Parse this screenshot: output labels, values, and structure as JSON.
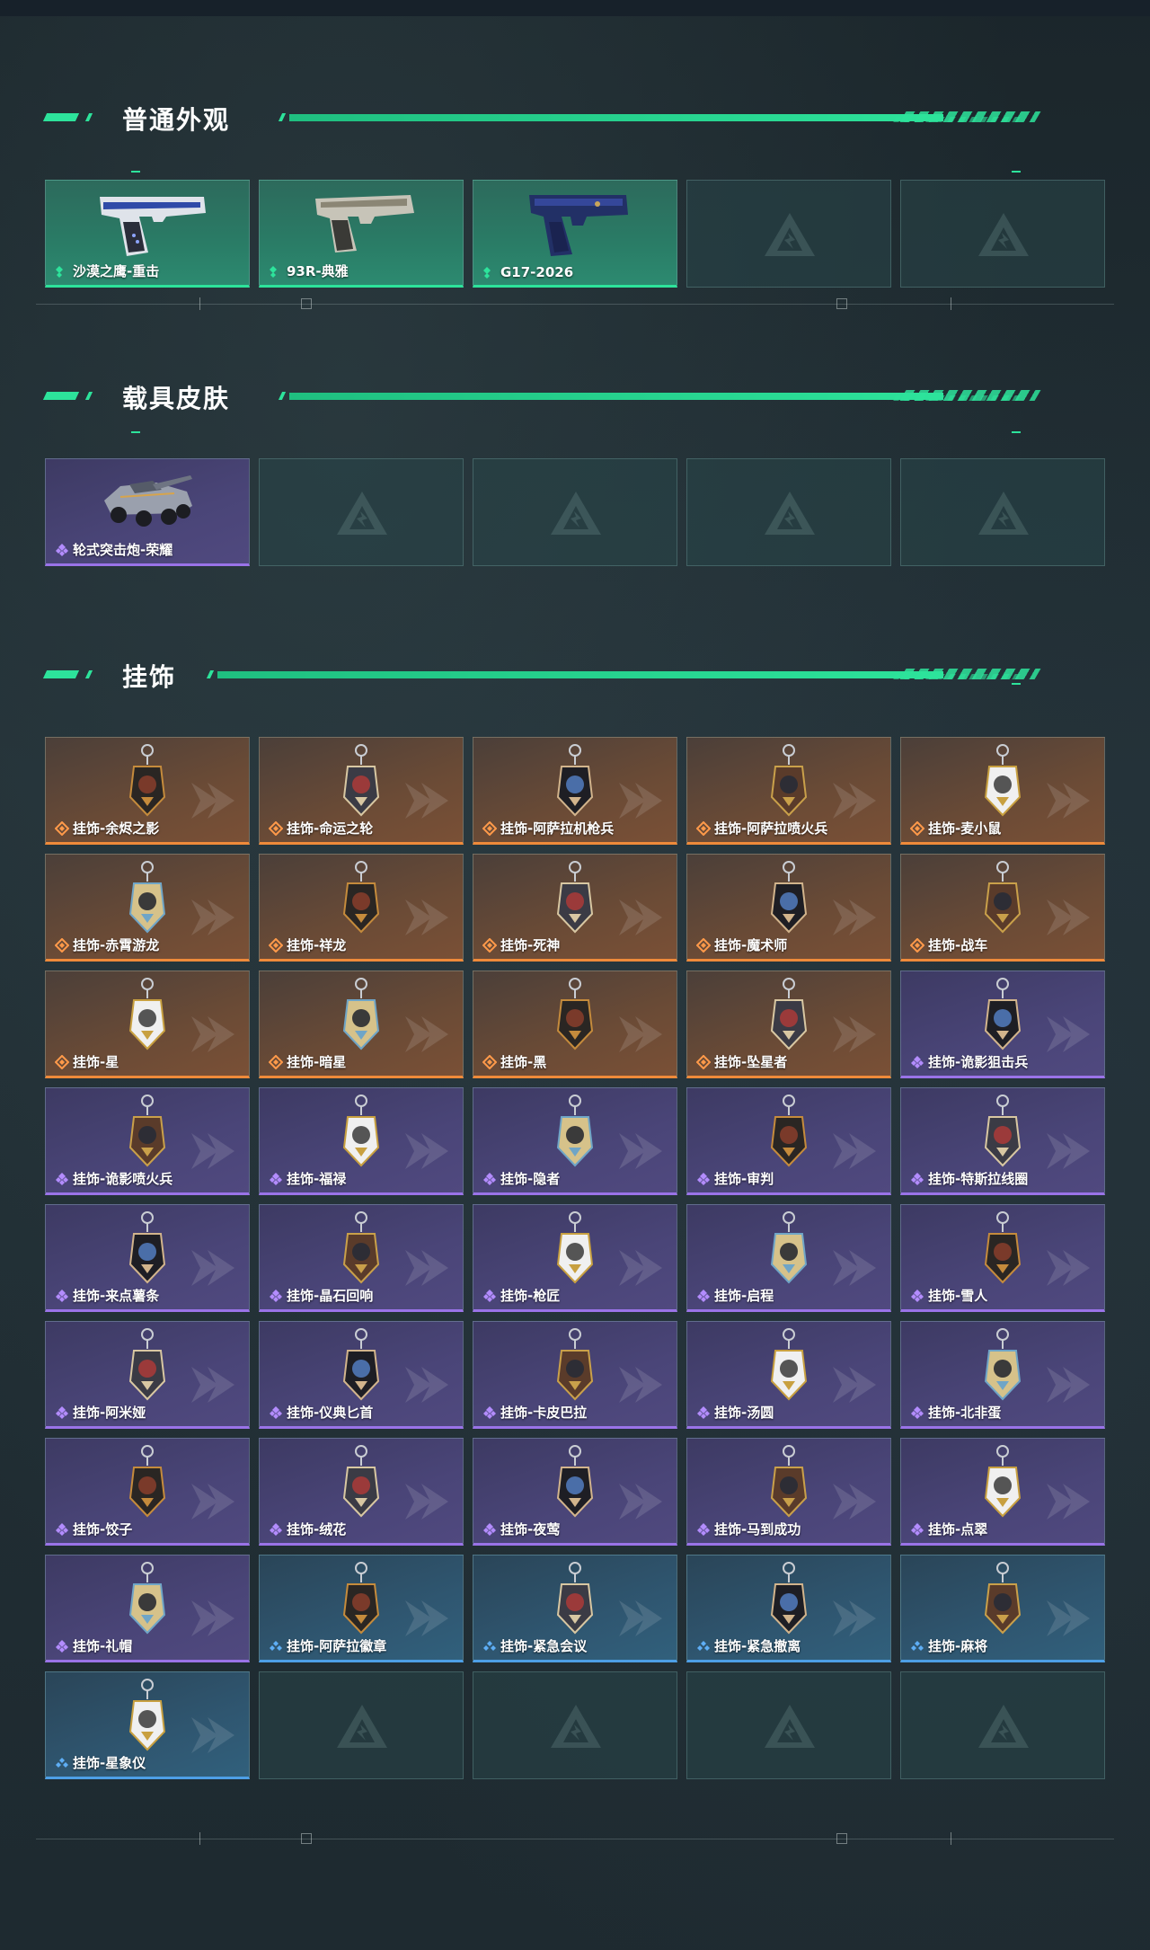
{
  "sections": [
    {
      "title": "普通外观",
      "items": [
        {
          "label": "沙漠之鹰-重击",
          "rarity": "green",
          "icon": "pistol-icon"
        },
        {
          "label": "93R-典雅",
          "rarity": "green",
          "icon": "pistol-icon"
        },
        {
          "label": "G17-2026",
          "rarity": "green",
          "icon": "pistol-icon"
        },
        {
          "empty": true
        },
        {
          "empty": true
        }
      ]
    },
    {
      "title": "载具皮肤",
      "items": [
        {
          "label": "轮式突击炮-荣耀",
          "rarity": "purple",
          "icon": "vehicle-icon"
        },
        {
          "empty": true
        },
        {
          "empty": true
        },
        {
          "empty": true
        },
        {
          "empty": true
        }
      ]
    },
    {
      "title": "挂饰",
      "items": [
        {
          "label": "挂饰-余烬之影",
          "rarity": "orange",
          "icon": "charm-figure-icon"
        },
        {
          "label": "挂饰-命运之轮",
          "rarity": "orange",
          "icon": "charm-card-icon"
        },
        {
          "label": "挂饰-阿萨拉机枪兵",
          "rarity": "orange",
          "icon": "charm-figure-icon"
        },
        {
          "label": "挂饰-阿萨拉喷火兵",
          "rarity": "orange",
          "icon": "charm-figure-icon"
        },
        {
          "label": "挂饰-麦小鼠",
          "rarity": "orange",
          "icon": "charm-mouse-icon"
        },
        {
          "label": "挂饰-赤霄游龙",
          "rarity": "orange",
          "icon": "charm-dragon-icon"
        },
        {
          "label": "挂饰-祥龙",
          "rarity": "orange",
          "icon": "charm-dragon-icon"
        },
        {
          "label": "挂饰-死神",
          "rarity": "orange",
          "icon": "charm-card-icon"
        },
        {
          "label": "挂饰-魔术师",
          "rarity": "orange",
          "icon": "charm-card-icon"
        },
        {
          "label": "挂饰-战车",
          "rarity": "orange",
          "icon": "charm-card-icon"
        },
        {
          "label": "挂饰-星",
          "rarity": "orange",
          "icon": "charm-card-icon"
        },
        {
          "label": "挂饰-暗星",
          "rarity": "orange",
          "icon": "charm-blade-icon"
        },
        {
          "label": "挂饰-黑",
          "rarity": "orange",
          "icon": "charm-tag-icon"
        },
        {
          "label": "挂饰-坠星者",
          "rarity": "orange",
          "icon": "charm-crystal-icon"
        },
        {
          "label": "挂饰-诡影狙击兵",
          "rarity": "purple",
          "icon": "charm-figure-icon"
        },
        {
          "label": "挂饰-诡影喷火兵",
          "rarity": "purple",
          "icon": "charm-figure-icon"
        },
        {
          "label": "挂饰-福禄",
          "rarity": "purple",
          "icon": "charm-gourd-icon"
        },
        {
          "label": "挂饰-隐者",
          "rarity": "purple",
          "icon": "charm-card-icon"
        },
        {
          "label": "挂饰-审判",
          "rarity": "purple",
          "icon": "charm-card-icon"
        },
        {
          "label": "挂饰-特斯拉线圈",
          "rarity": "purple",
          "icon": "charm-coil-icon"
        },
        {
          "label": "挂饰-来点薯条",
          "rarity": "purple",
          "icon": "charm-fries-icon"
        },
        {
          "label": "挂饰-晶石回响",
          "rarity": "purple",
          "icon": "charm-crystal-icon"
        },
        {
          "label": "挂饰-枪匠",
          "rarity": "purple",
          "icon": "charm-box-icon"
        },
        {
          "label": "挂饰-启程",
          "rarity": "purple",
          "icon": "charm-ring-icon"
        },
        {
          "label": "挂饰-雪人",
          "rarity": "purple",
          "icon": "charm-snowman-icon"
        },
        {
          "label": "挂饰-阿米娅",
          "rarity": "purple",
          "icon": "charm-figure-icon"
        },
        {
          "label": "挂饰-仪典匕首",
          "rarity": "purple",
          "icon": "charm-blade-icon"
        },
        {
          "label": "挂饰-卡皮巴拉",
          "rarity": "purple",
          "icon": "charm-capybara-icon"
        },
        {
          "label": "挂饰-汤圆",
          "rarity": "purple",
          "icon": "charm-bowl-icon"
        },
        {
          "label": "挂饰-北非蛋",
          "rarity": "purple",
          "icon": "charm-bowl-icon"
        },
        {
          "label": "挂饰-饺子",
          "rarity": "purple",
          "icon": "charm-bowl-icon"
        },
        {
          "label": "挂饰-绒花",
          "rarity": "purple",
          "icon": "charm-flower-icon"
        },
        {
          "label": "挂饰-夜莺",
          "rarity": "purple",
          "icon": "charm-feather-icon"
        },
        {
          "label": "挂饰-马到成功",
          "rarity": "purple",
          "icon": "charm-horse-icon"
        },
        {
          "label": "挂饰-点翠",
          "rarity": "purple",
          "icon": "charm-hairpin-icon"
        },
        {
          "label": "挂饰-礼帽",
          "rarity": "purple",
          "icon": "charm-hat-icon"
        },
        {
          "label": "挂饰-阿萨拉徽章",
          "rarity": "blue",
          "icon": "charm-badge-icon"
        },
        {
          "label": "挂饰-紧急会议",
          "rarity": "blue",
          "icon": "charm-badge-icon"
        },
        {
          "label": "挂饰-紧急撤离",
          "rarity": "blue",
          "icon": "charm-tag-icon"
        },
        {
          "label": "挂饰-麻将",
          "rarity": "blue",
          "icon": "charm-mahjong-icon"
        },
        {
          "label": "挂饰-星象仪",
          "rarity": "blue",
          "icon": "charm-astrolabe-icon"
        },
        {
          "empty": true
        },
        {
          "empty": true
        },
        {
          "empty": true
        },
        {
          "empty": true
        }
      ]
    }
  ],
  "colors": {
    "accent": "#2de39b",
    "green": "#2de39b",
    "purple": "#9a73e8",
    "orange": "#ef8a3a",
    "blue": "#4d9fe6"
  }
}
